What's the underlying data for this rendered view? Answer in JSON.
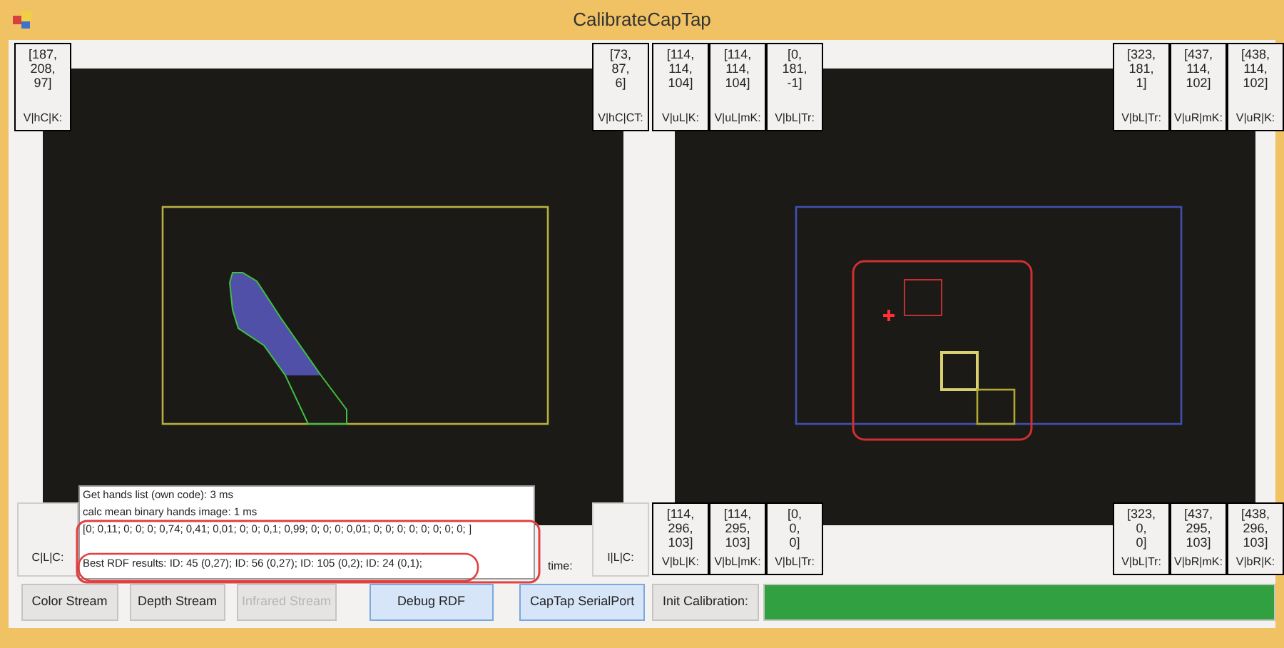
{
  "window": {
    "title": "CalibrateCapTap"
  },
  "left_view": {
    "top_left": [
      {
        "value_lines": [
          "[187,",
          "208,",
          "97]"
        ],
        "label": "V|hC|K:"
      }
    ],
    "top_right": [
      {
        "value_lines": [
          "[73,",
          "87,",
          "6]"
        ],
        "label": "V|hC|CT:"
      }
    ],
    "bottom_left_label": "C|L|C:",
    "time_label": "time:",
    "bottom_right_label": "I|L|C:"
  },
  "right_view": {
    "top_left": [
      {
        "value_lines": [
          "[114,",
          "114,",
          "104]"
        ],
        "label": "V|uL|K:"
      },
      {
        "value_lines": [
          "[114,",
          "114,",
          "104]"
        ],
        "label": "V|uL|mK:"
      },
      {
        "value_lines": [
          "[0,",
          "181,",
          "-1]"
        ],
        "label": "V|bL|Tr:"
      }
    ],
    "top_right": [
      {
        "value_lines": [
          "[323,",
          "181,",
          "1]"
        ],
        "label": "V|bL|Tr:"
      },
      {
        "value_lines": [
          "[437,",
          "114,",
          "102]"
        ],
        "label": "V|uR|mK:"
      },
      {
        "value_lines": [
          "[438,",
          "114,",
          "102]"
        ],
        "label": "V|uR|K:"
      }
    ],
    "bottom_left": [
      {
        "value_lines": [
          "[114,",
          "296,",
          "103]"
        ],
        "label": "V|bL|K:"
      },
      {
        "value_lines": [
          "[114,",
          "295,",
          "103]"
        ],
        "label": "V|bL|mK:"
      },
      {
        "value_lines": [
          "[0,",
          "0,",
          "0]"
        ],
        "label": "V|bL|Tr:"
      }
    ],
    "bottom_right": [
      {
        "value_lines": [
          "[323,",
          "0,",
          "0]"
        ],
        "label": "V|bL|Tr:"
      },
      {
        "value_lines": [
          "[437,",
          "295,",
          "103]"
        ],
        "label": "V|bR|mK:"
      },
      {
        "value_lines": [
          "[438,",
          "296,",
          "103]"
        ],
        "label": "V|bR|K:"
      }
    ]
  },
  "log": {
    "lines": [
      "Get hands list (own code): 3 ms",
      "calc mean binary hands image: 1 ms",
      "[0; 0,11; 0; 0; 0; 0,74; 0,41; 0,01; 0; 0; 0,1; 0,99; 0; 0; 0; 0,01; 0; 0; 0; 0; 0; 0; 0; 0; ]"
    ],
    "results": "Best RDF results: ID: 45 (0,27); ID: 56 (0,27); ID: 105 (0,2); ID: 24 (0,1);"
  },
  "buttons": [
    {
      "label": "Color Stream",
      "disabled": false,
      "highlighted": false
    },
    {
      "label": "Depth Stream",
      "disabled": false,
      "highlighted": false
    },
    {
      "label": "Infrared Stream",
      "disabled": true,
      "highlighted": false
    },
    {
      "label": "Debug RDF",
      "disabled": false,
      "highlighted": true
    },
    {
      "label": "CapTap SerialPort",
      "disabled": false,
      "highlighted": true
    },
    {
      "label": "Init Calibration:",
      "disabled": false,
      "highlighted": false
    }
  ],
  "calibration_progress": {
    "level": 1
  }
}
